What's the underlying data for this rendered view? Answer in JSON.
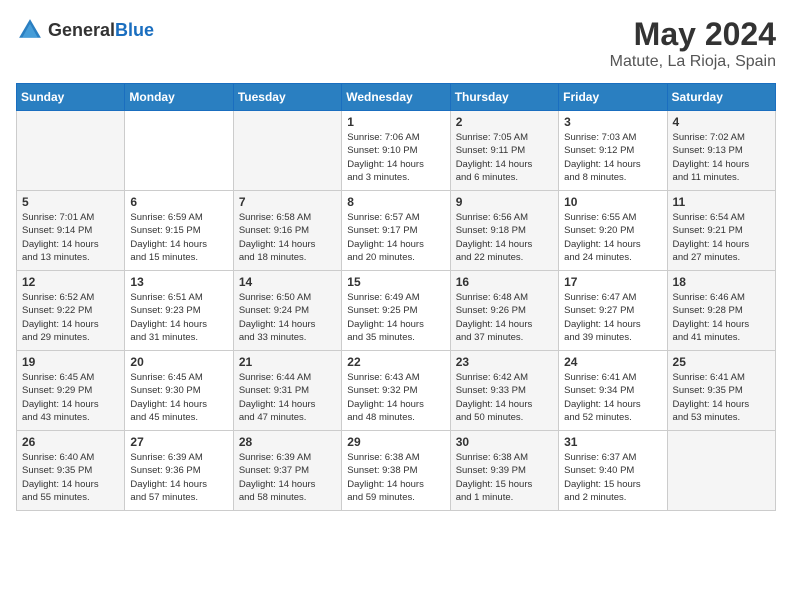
{
  "header": {
    "logo": {
      "general": "General",
      "blue": "Blue"
    },
    "title": "May 2024",
    "subtitle": "Matute, La Rioja, Spain"
  },
  "days_of_week": [
    "Sunday",
    "Monday",
    "Tuesday",
    "Wednesday",
    "Thursday",
    "Friday",
    "Saturday"
  ],
  "weeks": [
    {
      "days": [
        {
          "number": "",
          "info": ""
        },
        {
          "number": "",
          "info": ""
        },
        {
          "number": "",
          "info": ""
        },
        {
          "number": "1",
          "info": "Sunrise: 7:06 AM\nSunset: 9:10 PM\nDaylight: 14 hours\nand 3 minutes."
        },
        {
          "number": "2",
          "info": "Sunrise: 7:05 AM\nSunset: 9:11 PM\nDaylight: 14 hours\nand 6 minutes."
        },
        {
          "number": "3",
          "info": "Sunrise: 7:03 AM\nSunset: 9:12 PM\nDaylight: 14 hours\nand 8 minutes."
        },
        {
          "number": "4",
          "info": "Sunrise: 7:02 AM\nSunset: 9:13 PM\nDaylight: 14 hours\nand 11 minutes."
        }
      ]
    },
    {
      "days": [
        {
          "number": "5",
          "info": "Sunrise: 7:01 AM\nSunset: 9:14 PM\nDaylight: 14 hours\nand 13 minutes."
        },
        {
          "number": "6",
          "info": "Sunrise: 6:59 AM\nSunset: 9:15 PM\nDaylight: 14 hours\nand 15 minutes."
        },
        {
          "number": "7",
          "info": "Sunrise: 6:58 AM\nSunset: 9:16 PM\nDaylight: 14 hours\nand 18 minutes."
        },
        {
          "number": "8",
          "info": "Sunrise: 6:57 AM\nSunset: 9:17 PM\nDaylight: 14 hours\nand 20 minutes."
        },
        {
          "number": "9",
          "info": "Sunrise: 6:56 AM\nSunset: 9:18 PM\nDaylight: 14 hours\nand 22 minutes."
        },
        {
          "number": "10",
          "info": "Sunrise: 6:55 AM\nSunset: 9:20 PM\nDaylight: 14 hours\nand 24 minutes."
        },
        {
          "number": "11",
          "info": "Sunrise: 6:54 AM\nSunset: 9:21 PM\nDaylight: 14 hours\nand 27 minutes."
        }
      ]
    },
    {
      "days": [
        {
          "number": "12",
          "info": "Sunrise: 6:52 AM\nSunset: 9:22 PM\nDaylight: 14 hours\nand 29 minutes."
        },
        {
          "number": "13",
          "info": "Sunrise: 6:51 AM\nSunset: 9:23 PM\nDaylight: 14 hours\nand 31 minutes."
        },
        {
          "number": "14",
          "info": "Sunrise: 6:50 AM\nSunset: 9:24 PM\nDaylight: 14 hours\nand 33 minutes."
        },
        {
          "number": "15",
          "info": "Sunrise: 6:49 AM\nSunset: 9:25 PM\nDaylight: 14 hours\nand 35 minutes."
        },
        {
          "number": "16",
          "info": "Sunrise: 6:48 AM\nSunset: 9:26 PM\nDaylight: 14 hours\nand 37 minutes."
        },
        {
          "number": "17",
          "info": "Sunrise: 6:47 AM\nSunset: 9:27 PM\nDaylight: 14 hours\nand 39 minutes."
        },
        {
          "number": "18",
          "info": "Sunrise: 6:46 AM\nSunset: 9:28 PM\nDaylight: 14 hours\nand 41 minutes."
        }
      ]
    },
    {
      "days": [
        {
          "number": "19",
          "info": "Sunrise: 6:45 AM\nSunset: 9:29 PM\nDaylight: 14 hours\nand 43 minutes."
        },
        {
          "number": "20",
          "info": "Sunrise: 6:45 AM\nSunset: 9:30 PM\nDaylight: 14 hours\nand 45 minutes."
        },
        {
          "number": "21",
          "info": "Sunrise: 6:44 AM\nSunset: 9:31 PM\nDaylight: 14 hours\nand 47 minutes."
        },
        {
          "number": "22",
          "info": "Sunrise: 6:43 AM\nSunset: 9:32 PM\nDaylight: 14 hours\nand 48 minutes."
        },
        {
          "number": "23",
          "info": "Sunrise: 6:42 AM\nSunset: 9:33 PM\nDaylight: 14 hours\nand 50 minutes."
        },
        {
          "number": "24",
          "info": "Sunrise: 6:41 AM\nSunset: 9:34 PM\nDaylight: 14 hours\nand 52 minutes."
        },
        {
          "number": "25",
          "info": "Sunrise: 6:41 AM\nSunset: 9:35 PM\nDaylight: 14 hours\nand 53 minutes."
        }
      ]
    },
    {
      "days": [
        {
          "number": "26",
          "info": "Sunrise: 6:40 AM\nSunset: 9:35 PM\nDaylight: 14 hours\nand 55 minutes."
        },
        {
          "number": "27",
          "info": "Sunrise: 6:39 AM\nSunset: 9:36 PM\nDaylight: 14 hours\nand 57 minutes."
        },
        {
          "number": "28",
          "info": "Sunrise: 6:39 AM\nSunset: 9:37 PM\nDaylight: 14 hours\nand 58 minutes."
        },
        {
          "number": "29",
          "info": "Sunrise: 6:38 AM\nSunset: 9:38 PM\nDaylight: 14 hours\nand 59 minutes."
        },
        {
          "number": "30",
          "info": "Sunrise: 6:38 AM\nSunset: 9:39 PM\nDaylight: 15 hours\nand 1 minute."
        },
        {
          "number": "31",
          "info": "Sunrise: 6:37 AM\nSunset: 9:40 PM\nDaylight: 15 hours\nand 2 minutes."
        },
        {
          "number": "",
          "info": ""
        }
      ]
    }
  ]
}
